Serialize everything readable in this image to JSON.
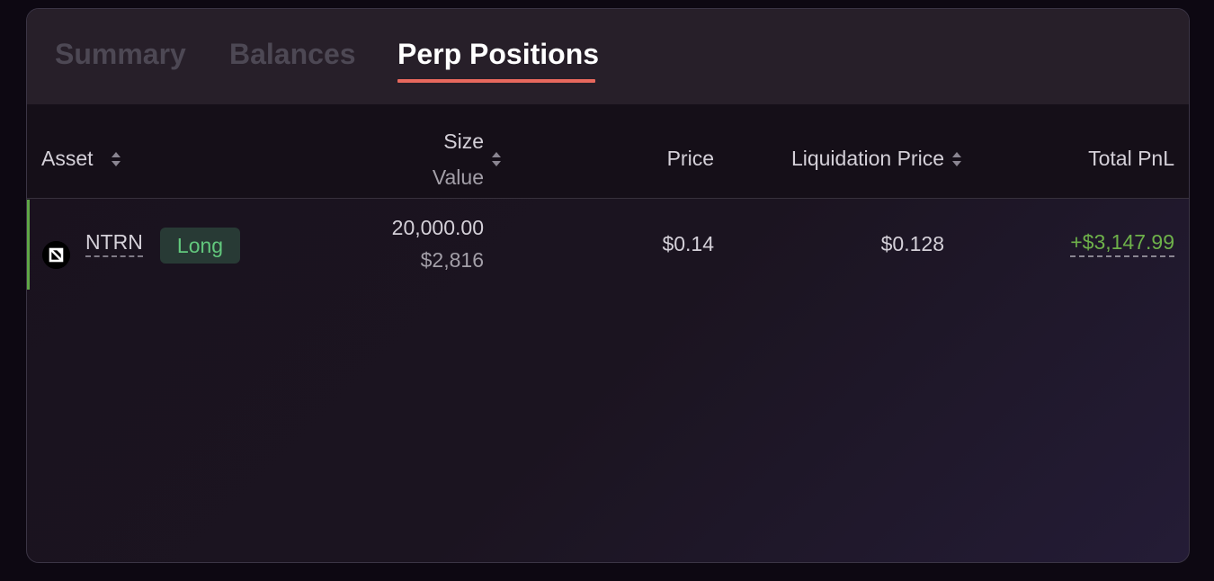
{
  "tabs": [
    {
      "label": "Summary",
      "active": false
    },
    {
      "label": "Balances",
      "active": false
    },
    {
      "label": "Perp Positions",
      "active": true
    }
  ],
  "table": {
    "headers": {
      "asset": "Asset",
      "size": "Size",
      "value": "Value",
      "price": "Price",
      "liquidation_price": "Liquidation Price",
      "total_pnl": "Total PnL"
    },
    "rows": [
      {
        "asset": "NTRN",
        "asset_icon": "neutron-logo-icon",
        "side": "Long",
        "size": "20,000.00",
        "value": "$2,816",
        "price": "$0.14",
        "liquidation_price": "$0.128",
        "total_pnl": "+$3,147.99"
      }
    ]
  },
  "colors": {
    "accent": "#e8685d",
    "positive": "#6eb14a",
    "long_badge_text": "#62c87d",
    "long_badge_bg": "#283a35",
    "row_accent": "#5fa746"
  }
}
